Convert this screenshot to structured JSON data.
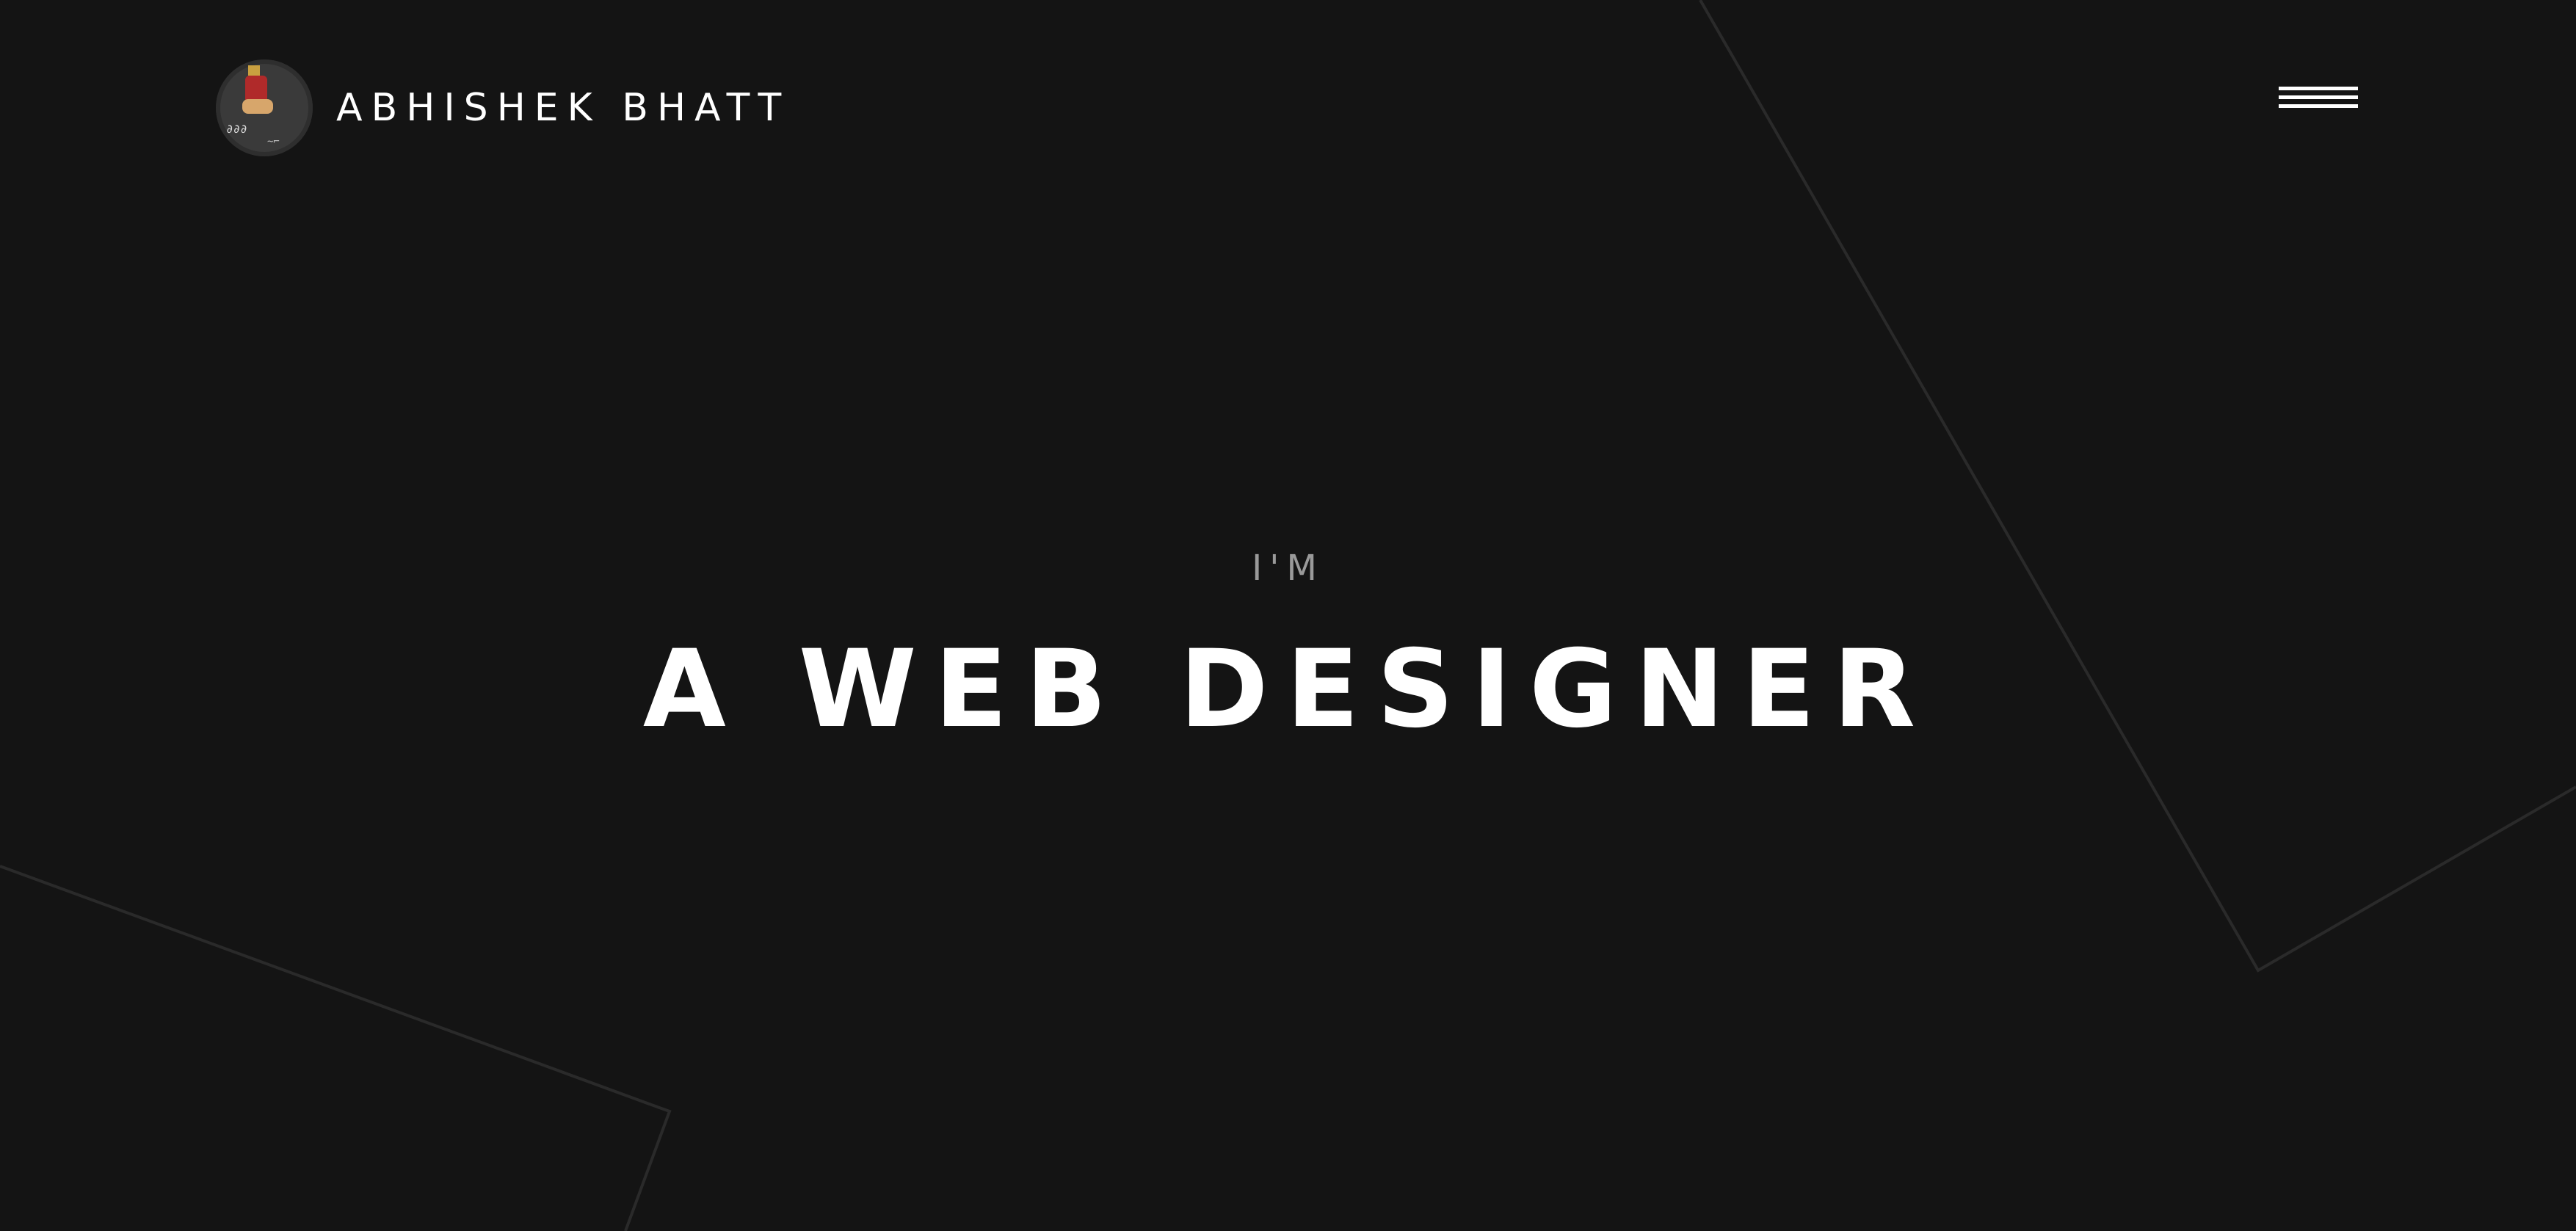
{
  "header": {
    "brand_name": "ABHISHEK BHATT",
    "avatar_icon": "profile-photo",
    "menu_icon": "hamburger-menu-icon"
  },
  "hero": {
    "intro": "I'M",
    "headline": "A WEB DESIGNER"
  },
  "colors": {
    "background": "#141414",
    "text_primary": "#ffffff",
    "text_secondary": "#9a9a9a",
    "decor_line": "#2a2a2a"
  }
}
